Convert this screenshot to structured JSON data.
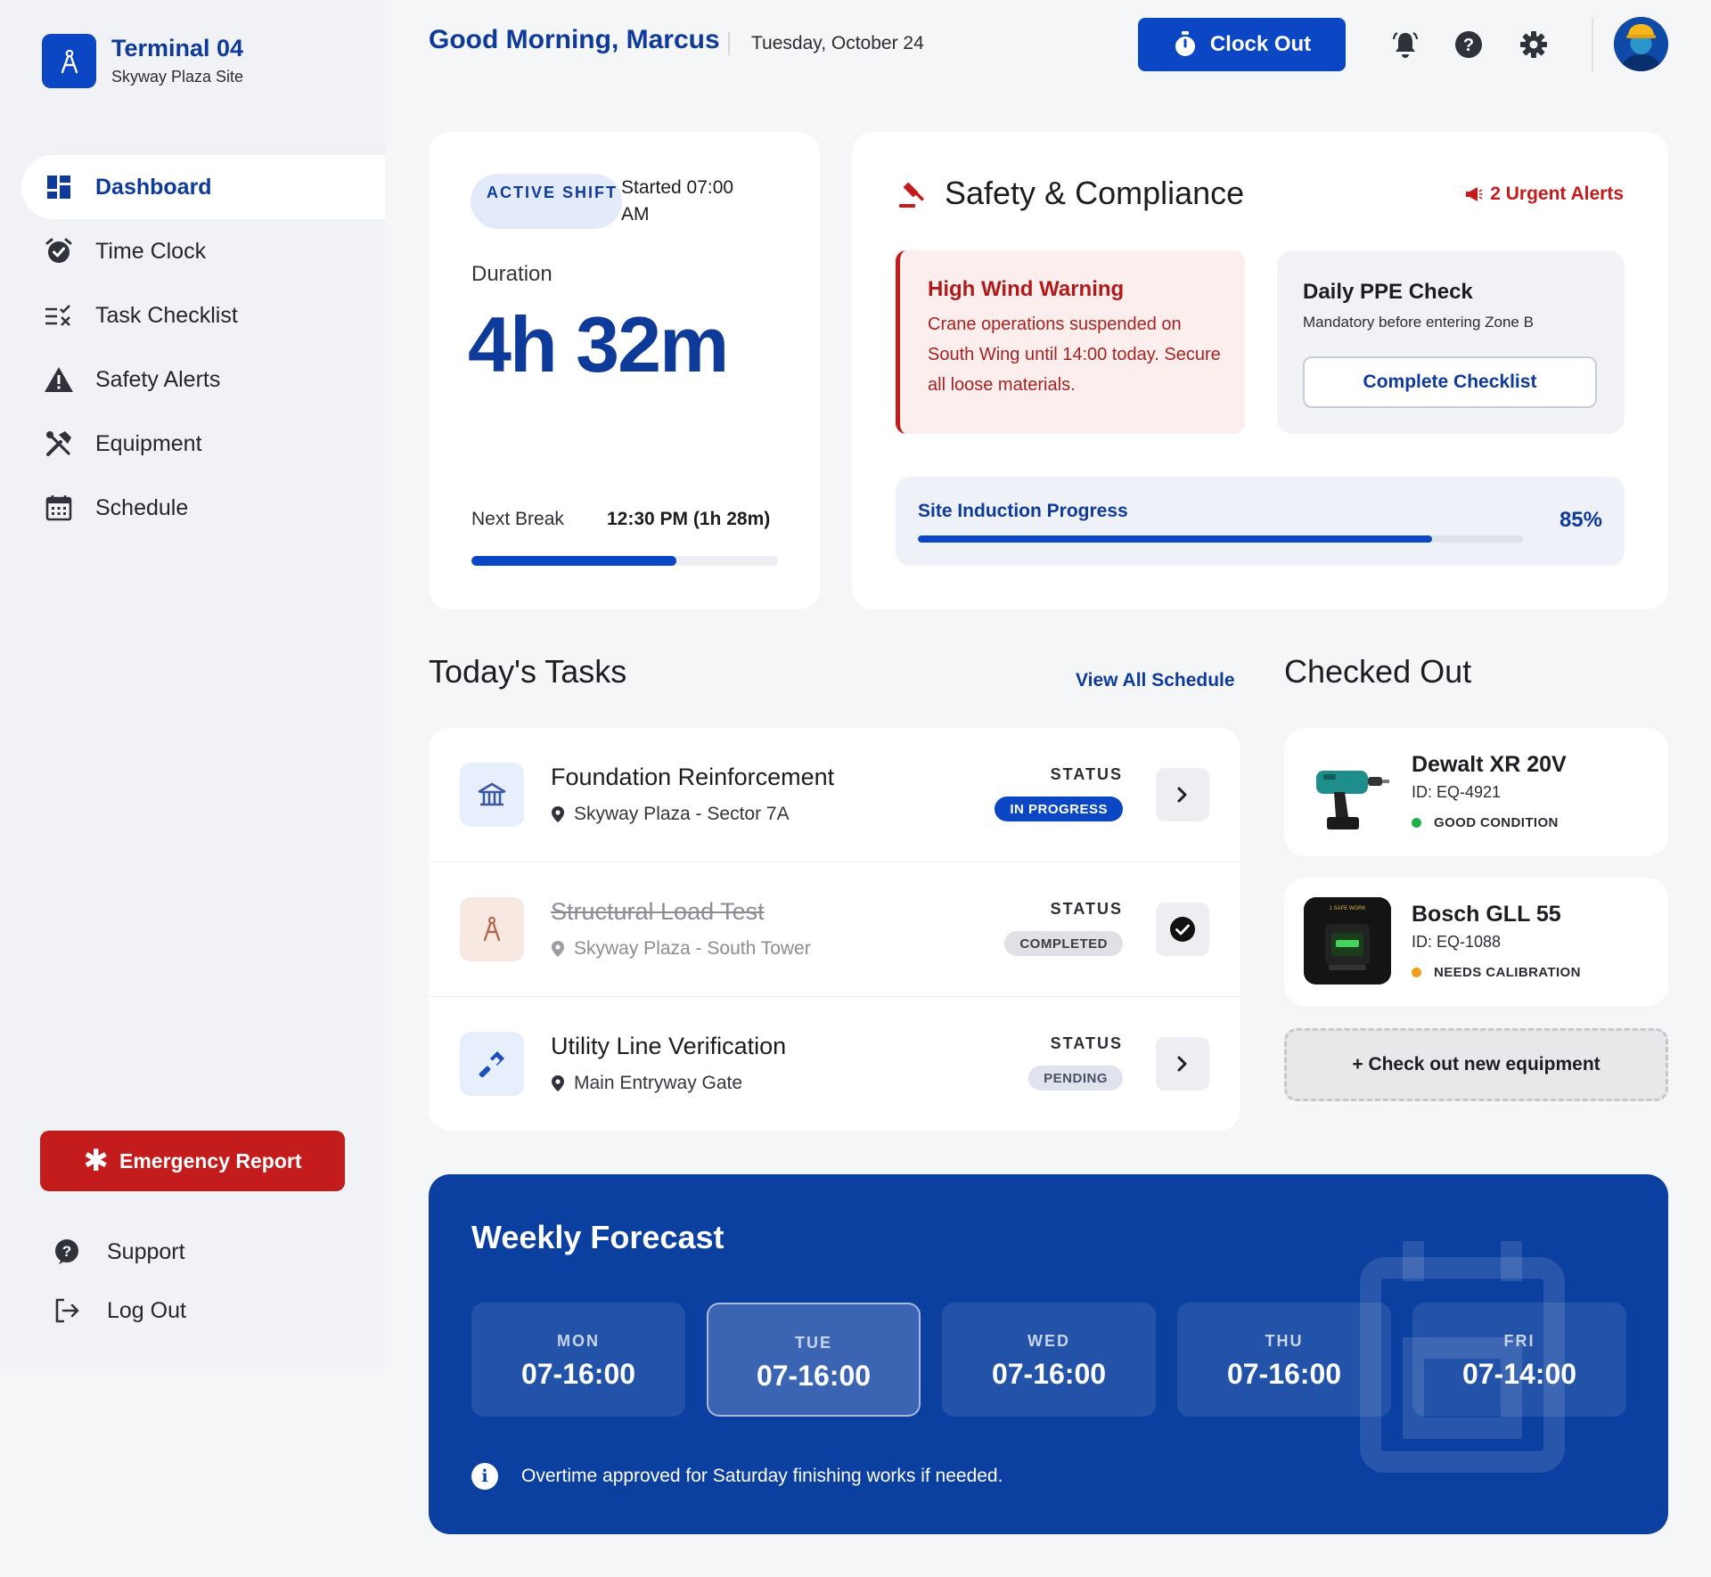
{
  "brand": {
    "title": "Terminal 04",
    "subtitle": "Skyway Plaza Site"
  },
  "sidebar": {
    "items": [
      {
        "label": "Dashboard",
        "icon": "dashboard-icon",
        "active": true
      },
      {
        "label": "Time Clock",
        "icon": "alarm-clock-icon"
      },
      {
        "label": "Task Checklist",
        "icon": "checklist-icon"
      },
      {
        "label": "Safety Alerts",
        "icon": "warning-icon"
      },
      {
        "label": "Equipment",
        "icon": "tools-icon"
      },
      {
        "label": "Schedule",
        "icon": "calendar-icon"
      }
    ],
    "emergency_label": "Emergency Report",
    "support_label": "Support",
    "logout_label": "Log Out"
  },
  "header": {
    "greeting": "Good Morning, Marcus",
    "date": "Tuesday, October 24",
    "clock_out_label": "Clock Out"
  },
  "shift": {
    "badge": "ACTIVE SHIFT",
    "started": "Started 07:00 AM",
    "duration_label": "Duration",
    "duration_value": "4h 32m",
    "next_break_label": "Next Break",
    "next_break_value": "12:30 PM (1h 28m)",
    "break_progress": 0.67
  },
  "safety": {
    "title": "Safety & Compliance",
    "urgent_alerts": "2 Urgent Alerts",
    "warning": {
      "title": "High Wind Warning",
      "body": "Crane operations suspended on South Wing until 14:00 today. Secure all loose materials."
    },
    "ppe": {
      "title": "Daily PPE Check",
      "subtitle": "Mandatory before entering Zone B",
      "button": "Complete Checklist"
    },
    "induction": {
      "label": "Site Induction Progress",
      "percent_label": "85%",
      "progress": 0.85
    }
  },
  "tasks": {
    "title": "Today's Tasks",
    "view_all": "View All Schedule",
    "status_label": "STATUS",
    "items": [
      {
        "title": "Foundation Reinforcement",
        "location": "Skyway Plaza - Sector 7A",
        "status": "IN PROGRESS",
        "done": false,
        "icon": "structure-icon"
      },
      {
        "title": "Structural Load Test",
        "location": "Skyway Plaza - South Tower",
        "status": "COMPLETED",
        "done": true,
        "icon": "compass-icon"
      },
      {
        "title": "Utility Line Verification",
        "location": "Main Entryway Gate",
        "status": "PENDING",
        "done": false,
        "icon": "wrench-icon"
      }
    ]
  },
  "checked_out": {
    "title": "Checked Out",
    "items": [
      {
        "name": "Dewalt XR 20V",
        "id": "ID: EQ-4921",
        "condition": "GOOD CONDITION",
        "condition_color": "#22b04b"
      },
      {
        "name": "Bosch GLL 55",
        "id": "ID: EQ-1088",
        "condition": "NEEDS CALIBRATION",
        "condition_color": "#f0a01a",
        "image_label": "1 SAFE WORK"
      }
    ],
    "add_label": "+ Check out new equipment"
  },
  "forecast": {
    "title": "Weekly Forecast",
    "days": [
      {
        "day": "MON",
        "hours": "07-16:00"
      },
      {
        "day": "TUE",
        "hours": "07-16:00",
        "active": true
      },
      {
        "day": "WED",
        "hours": "07-16:00"
      },
      {
        "day": "THU",
        "hours": "07-16:00"
      },
      {
        "day": "FRI",
        "hours": "07-14:00"
      }
    ],
    "note": "Overtime approved for Saturday finishing works if needed."
  },
  "colors": {
    "primary": "#0b46c4",
    "primary_dark": "#0e3a9a",
    "danger": "#c41c1c",
    "forecast_bg": "#0b3fa0"
  }
}
